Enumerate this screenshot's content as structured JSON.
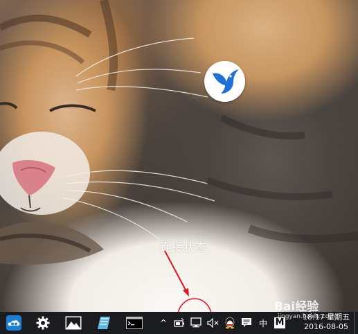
{
  "desktop": {
    "wallpaper": "cat-photo",
    "icons": [
      {
        "name": "xunlei-bird-icon",
        "color": "#1e6fd8"
      }
    ]
  },
  "annotation": {
    "text": "连接状态",
    "color": "#e0141e"
  },
  "taskbar": {
    "background": "#1a1c20",
    "apps": [
      {
        "name": "cloud-app-icon",
        "color": "#1b7fd6"
      },
      {
        "name": "settings-gear-icon",
        "color": "#ffffff"
      },
      {
        "name": "photos-app-icon",
        "color": "#ffffff"
      },
      {
        "name": "notes-app-icon",
        "color": "#5fb6e8"
      },
      {
        "name": "cmd-terminal-icon",
        "color": "#c0c0c0"
      }
    ],
    "tray": {
      "show_hidden": "^",
      "ime_label": "中",
      "m_label": "M",
      "icons": [
        "chevron-up-icon",
        "battery-icon",
        "network-icon",
        "volume-muted-icon",
        "qq-penguin-icon",
        "action-center-icon",
        "ime-icon",
        "m-app-icon"
      ]
    },
    "clock": {
      "time": "18:17 星期五",
      "date": "2016-08-05"
    }
  },
  "watermark": {
    "logo": "Bai经验",
    "url": "jingyan.baidu.com"
  }
}
